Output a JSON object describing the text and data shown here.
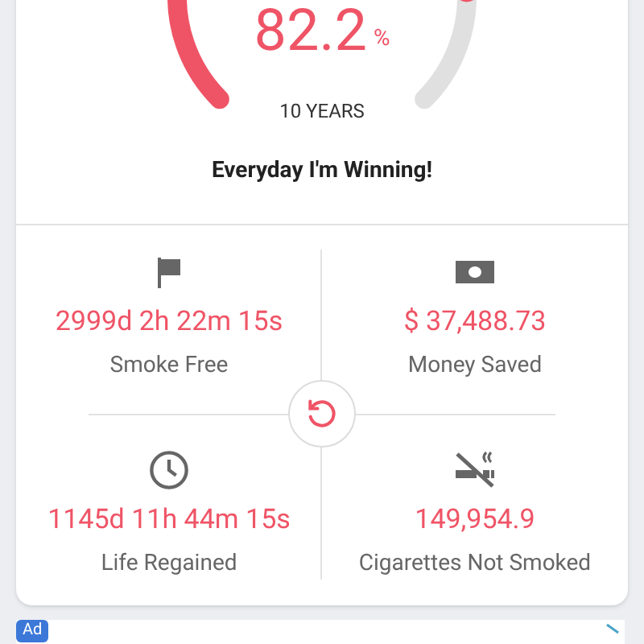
{
  "gauge": {
    "percent": "82.2",
    "unit": "%",
    "caption": "10 YEARS"
  },
  "motto": "Everyday I'm Winning!",
  "stats": [
    {
      "kind": "flag",
      "value": "2999d 2h 22m 15s",
      "label": "Smoke Free"
    },
    {
      "kind": "money",
      "value": "$ 37,488.73",
      "label": "Money Saved"
    },
    {
      "kind": "clock",
      "value": "1145d 11h 44m 15s",
      "label": "Life Regained"
    },
    {
      "kind": "no-smoking",
      "value": "149,954.9",
      "label": "Cigarettes Not Smoked"
    }
  ],
  "ad": {
    "badge": "Ad"
  }
}
